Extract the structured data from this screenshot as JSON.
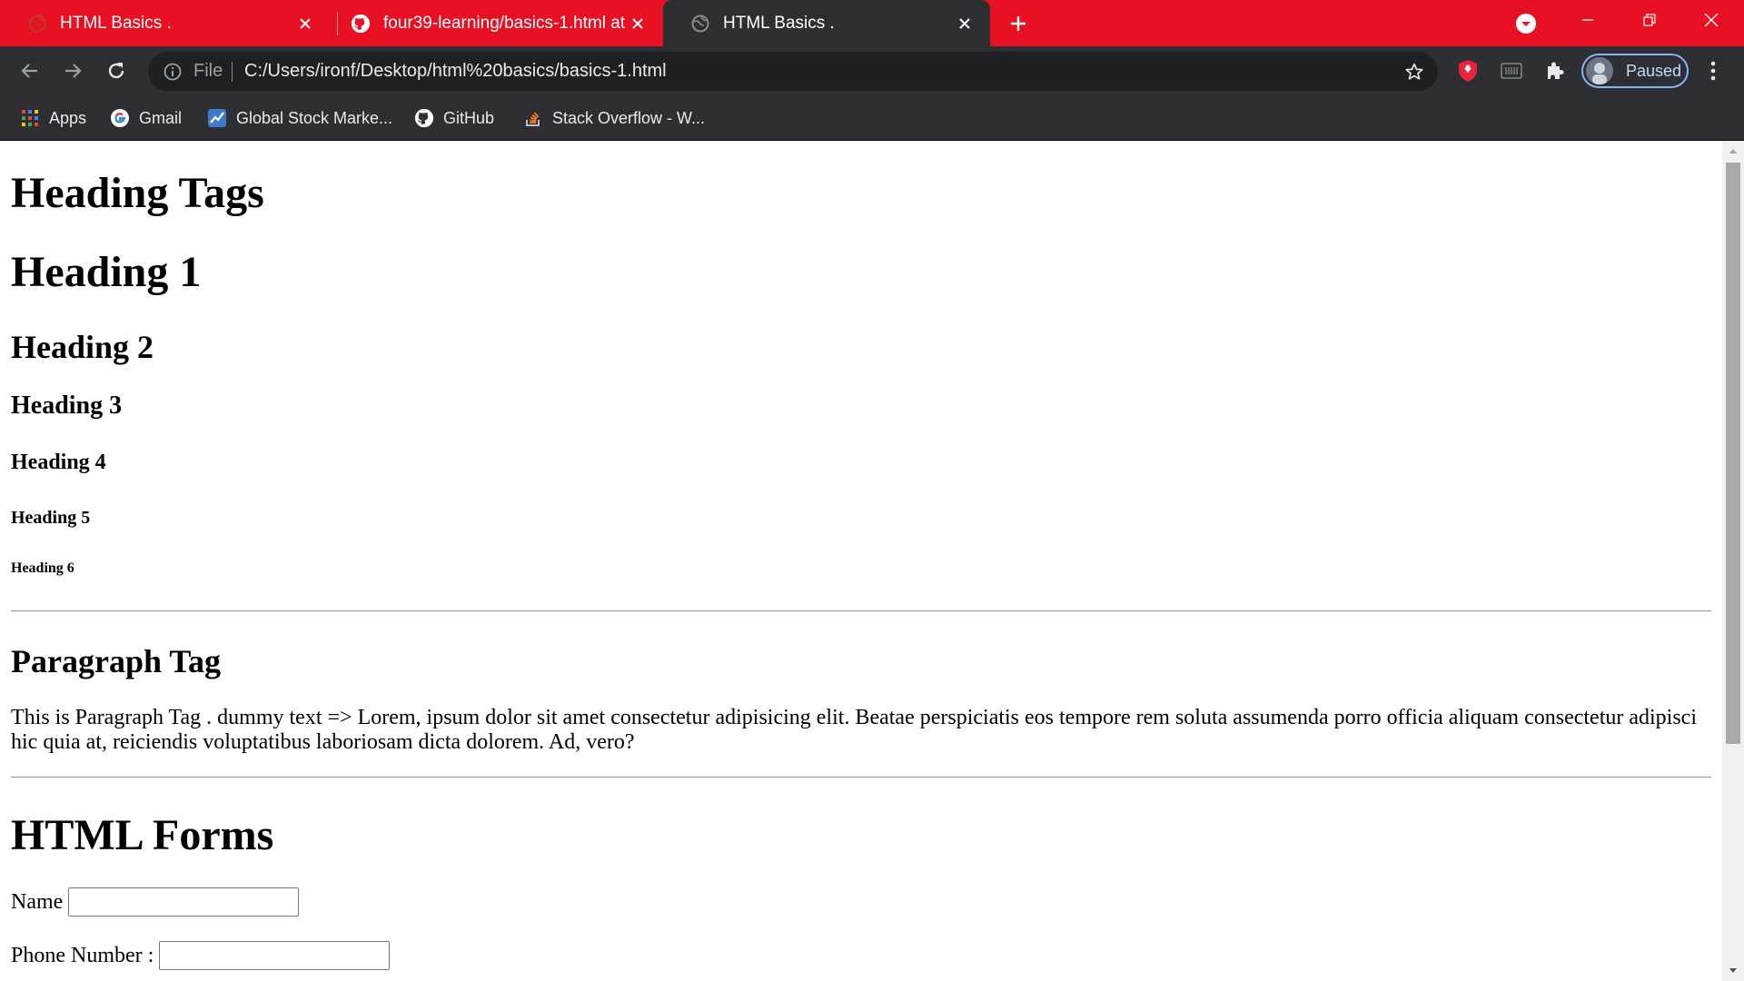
{
  "tabs": [
    {
      "title": "HTML Basics .",
      "favicon": "globe-icon",
      "active": false
    },
    {
      "title": "four39-learning/basics-1.html at",
      "favicon": "github-icon",
      "active": false
    },
    {
      "title": "HTML Basics .",
      "favicon": "globe-icon",
      "active": true
    }
  ],
  "toolbar": {
    "file_label": "File",
    "url": "C:/Users/ironf/Desktop/html%20basics/basics-1.html",
    "profile_label": "Paused"
  },
  "bookmarks": [
    {
      "label": "Apps",
      "icon": "apps-grid-icon"
    },
    {
      "label": "Gmail",
      "icon": "google-icon"
    },
    {
      "label": "Global Stock Marke...",
      "icon": "stock-icon"
    },
    {
      "label": "GitHub",
      "icon": "github-icon"
    },
    {
      "label": "Stack Overflow - W...",
      "icon": "stackoverflow-icon"
    }
  ],
  "page": {
    "heading_tags": "Heading Tags",
    "h1": "Heading 1",
    "h2": "Heading 2",
    "h3": "Heading 3",
    "h4": "Heading 4",
    "h5": "Heading 5",
    "h6": "Heading 6",
    "paragraph_heading": "Paragraph Tag",
    "paragraph_text": "This is Paragraph Tag . dummy text => Lorem, ipsum dolor sit amet consectetur adipisicing elit. Beatae perspiciatis eos tempore rem soluta assumenda porro officia aliquam consectetur adipisci hic quia at, reiciendis voluptatibus laboriosam dicta dolorem. Ad, vero?",
    "forms_heading": "HTML Forms",
    "form": {
      "name_label": "Name",
      "name_value": "",
      "phone_label": "Phone Number :",
      "phone_value": ""
    }
  },
  "colors": {
    "tabstrip": "#e81123",
    "toolbar": "#2e2f33",
    "omnibox": "#1f2023",
    "profile_ring": "#8ab4f8"
  }
}
